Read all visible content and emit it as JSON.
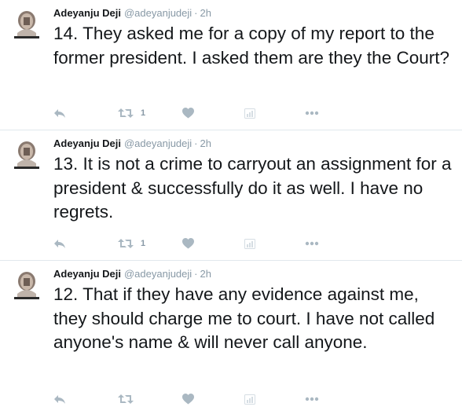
{
  "tweets": [
    {
      "name": "Adeyanju Deji",
      "handle": "@adeyanjudeji",
      "separator": "·",
      "time": "2h",
      "text": "14. They asked me for a copy of my report to the former president. I asked them are they the Court?",
      "retweet_count": "1"
    },
    {
      "name": "Adeyanju Deji",
      "handle": "@adeyanjudeji",
      "separator": "·",
      "time": "2h",
      "text": "13. It is not a crime to carryout an assignment for a president & successfully do it as well. I have no regrets.",
      "retweet_count": "1"
    },
    {
      "name": "Adeyanju Deji",
      "handle": "@adeyanjudeji",
      "separator": "·",
      "time": "2h",
      "text": "12. That if they have any evidence against me, they should charge me to court. I have not called anyone's name & will never call anyone.",
      "retweet_count": ""
    }
  ],
  "icons": {
    "reply": "reply-icon",
    "retweet": "retweet-icon",
    "like": "heart-icon",
    "analytics": "analytics-icon",
    "more": "more-icon"
  },
  "colors": {
    "text": "#14171a",
    "muted": "#8899a6",
    "icon": "#aab8c2",
    "divider": "#e1e8ed"
  }
}
